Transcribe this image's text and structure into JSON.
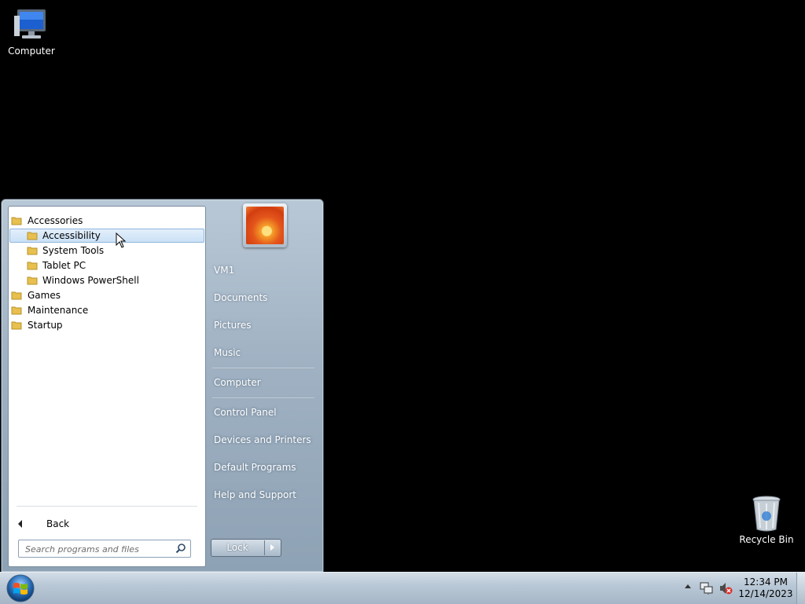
{
  "desktop": {
    "icons": [
      {
        "label": "Computer",
        "icon": "computer-icon"
      },
      {
        "label": "Recycle Bin",
        "icon": "recycle-bin-icon"
      }
    ]
  },
  "start_menu": {
    "programs": [
      {
        "label": "Accessories",
        "level": 0,
        "selected": false
      },
      {
        "label": "Accessibility",
        "level": 1,
        "selected": true
      },
      {
        "label": "System Tools",
        "level": 1,
        "selected": false
      },
      {
        "label": "Tablet PC",
        "level": 1,
        "selected": false
      },
      {
        "label": "Windows PowerShell",
        "level": 1,
        "selected": false
      },
      {
        "label": "Games",
        "level": 0,
        "selected": false
      },
      {
        "label": "Maintenance",
        "level": 0,
        "selected": false
      },
      {
        "label": "Startup",
        "level": 0,
        "selected": false
      }
    ],
    "back_label": "Back",
    "search_placeholder": "Search programs and files",
    "right_items": [
      {
        "label": "VM1"
      },
      {
        "label": "Documents"
      },
      {
        "label": "Pictures"
      },
      {
        "label": "Music"
      },
      {
        "label": "Computer"
      },
      {
        "label": "Control Panel"
      },
      {
        "label": "Devices and Printers"
      },
      {
        "label": "Default Programs"
      },
      {
        "label": "Help and Support"
      }
    ],
    "lock_label": "Lock"
  },
  "taskbar": {
    "time": "12:34 PM",
    "date": "12/14/2023"
  },
  "colors": {
    "desktop": "#000000",
    "selection": "#cbe1f6",
    "menu_glass": "#9fb1c2"
  }
}
